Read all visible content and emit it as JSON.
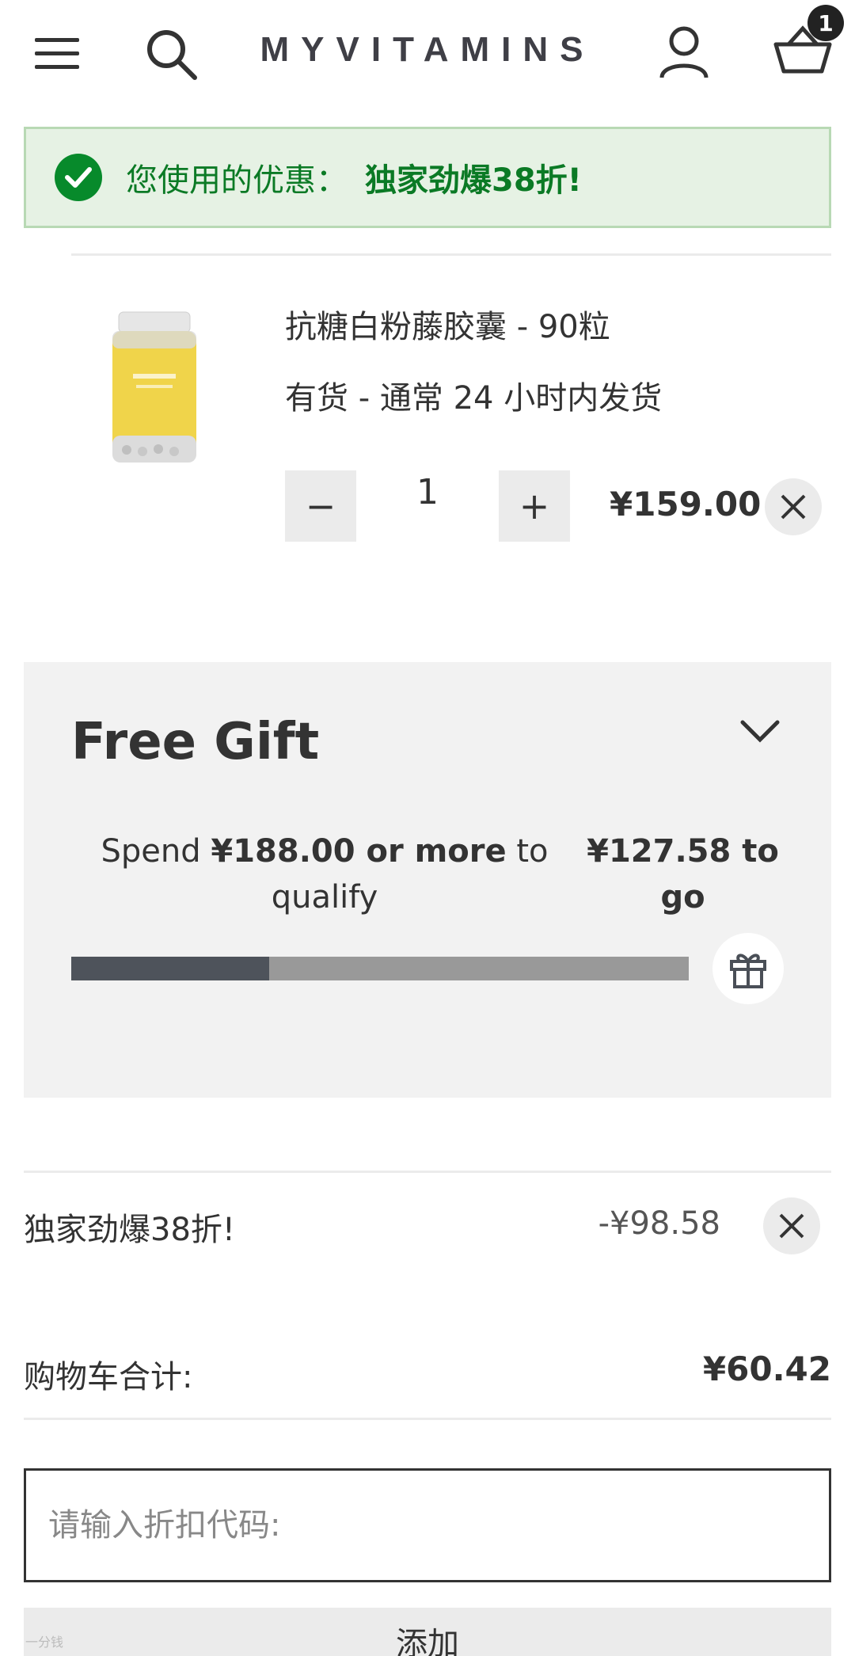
{
  "header": {
    "logo_text": "MYVITAMINS",
    "basket_count": "1"
  },
  "promo": {
    "label": "您使用的优惠：",
    "value": "独家劲爆38折!"
  },
  "cart_item": {
    "name": "抗糖白粉藤胶囊 - 90粒",
    "stock_status": "有货  -  通常 24 小时内发货",
    "quantity": "1",
    "price": "¥159.00",
    "decrease_symbol": "−",
    "increase_symbol": "+"
  },
  "free_gift": {
    "title": "Free Gift",
    "spend_prefix": "Spend ",
    "spend_amount": "¥188.00 or more",
    "spend_suffix": " to qualify",
    "to_go": "¥127.58 to go",
    "progress_fraction": 0.32
  },
  "discount": {
    "name": "独家劲爆38折!",
    "amount": "-¥98.58"
  },
  "total": {
    "label": "购物车合计:",
    "value": "¥60.42"
  },
  "code_entry": {
    "placeholder": "请输入折扣代码:",
    "button_label": "添加"
  },
  "watermark": "一分钱",
  "colors": {
    "promo_green": "#078a2b",
    "promo_bg": "#e6f2e4",
    "progress_fill": "#4e535b",
    "progress_track": "#999999"
  }
}
